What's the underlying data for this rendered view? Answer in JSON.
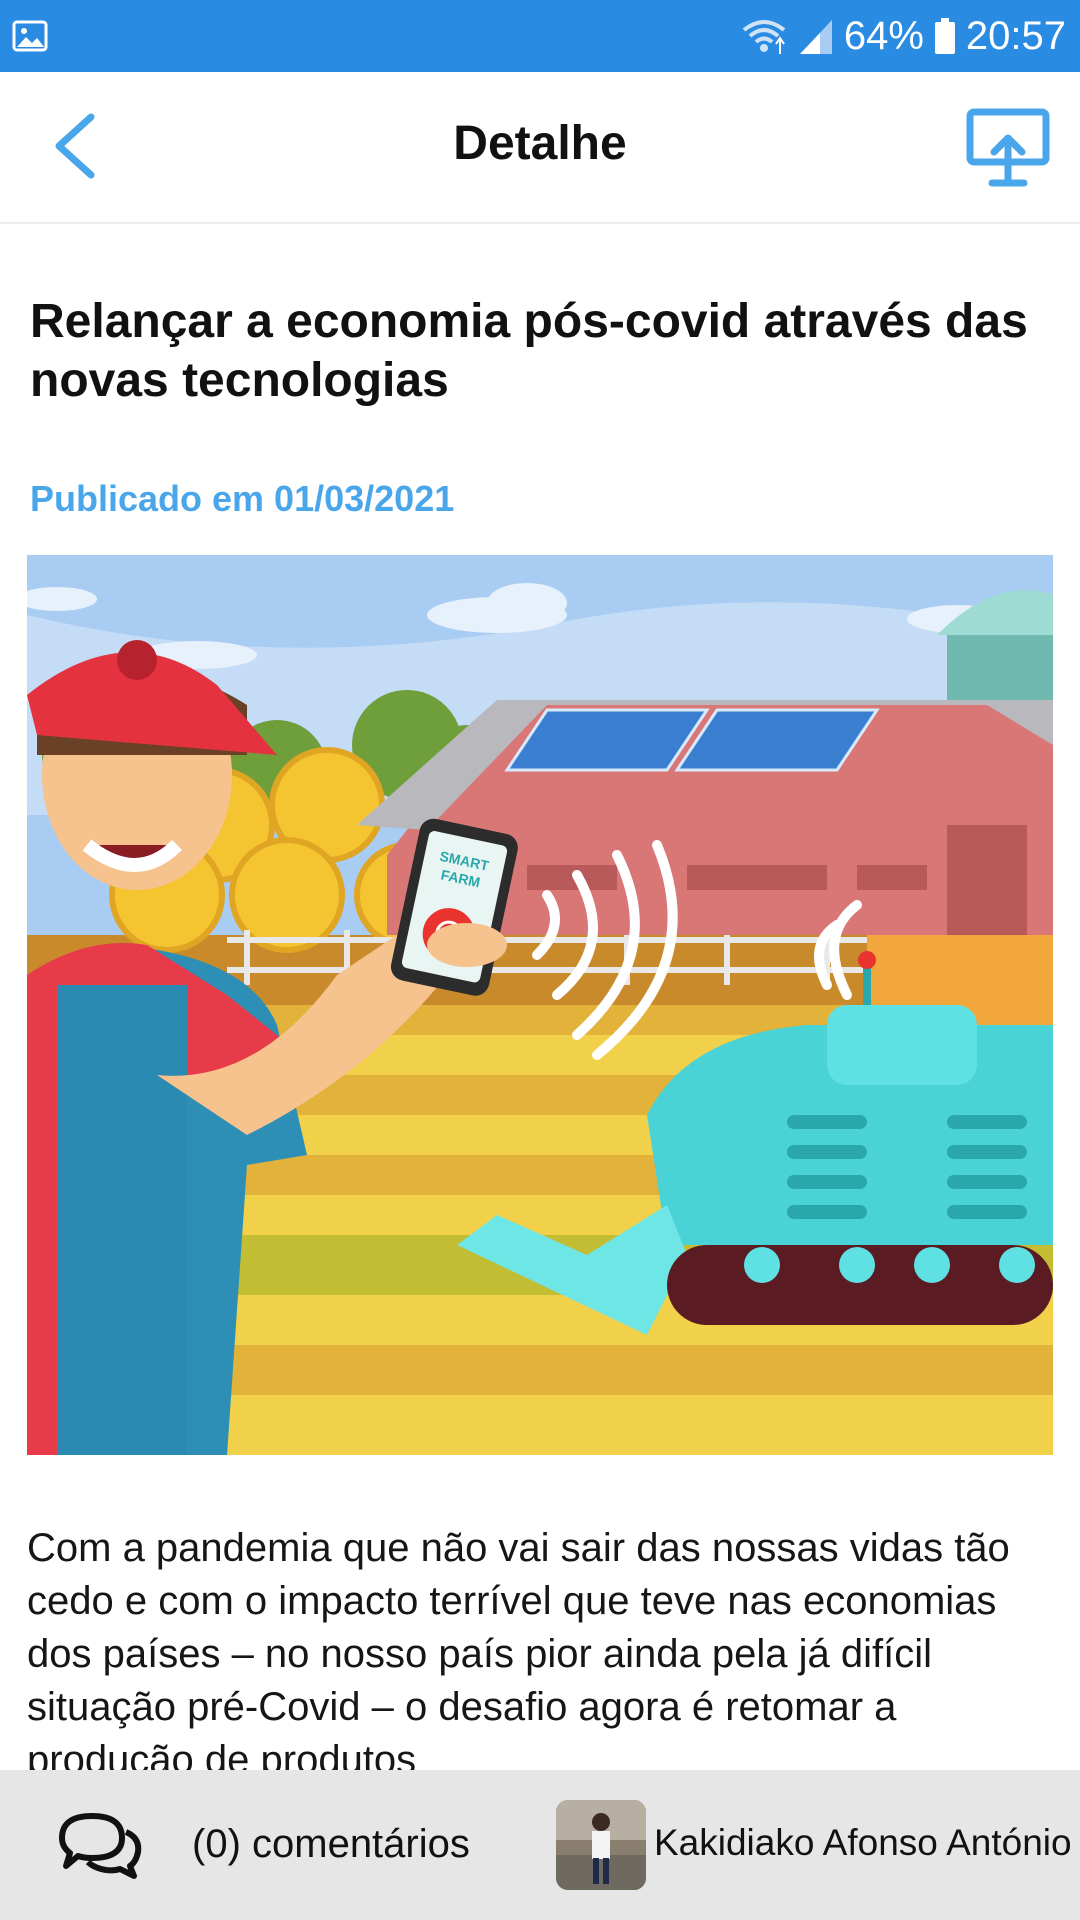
{
  "status_bar": {
    "battery": "64%",
    "time": "20:57",
    "icons": [
      "gallery-icon",
      "wifi-icon",
      "signal-icon",
      "battery-icon"
    ],
    "color": "#2a8be2"
  },
  "app_bar": {
    "title": "Detalhe",
    "back_icon": "chevron-left-icon",
    "share_icon": "share-screen-icon",
    "accent": "#4aa6ea"
  },
  "article": {
    "title": "Relançar a economia pós-covid através das novas tecnologias",
    "published": "Publicado em 01/03/2021",
    "image": "smart-farm-illustration",
    "image_text": [
      "SMART",
      "FARM"
    ],
    "body": "Com a pandemia que não vai sair das nossas vidas tão cedo e com o impacto terrível que teve nas economias dos países – no nosso país pior ainda pela já difícil situação pré-Covid – o desafio agora é retomar a produção de produtos"
  },
  "footer": {
    "comments_label": "(0) comentários",
    "comments_icon": "chat-bubbles-icon",
    "author": "Kakidiako Afonso António",
    "avatar": "author-avatar"
  }
}
